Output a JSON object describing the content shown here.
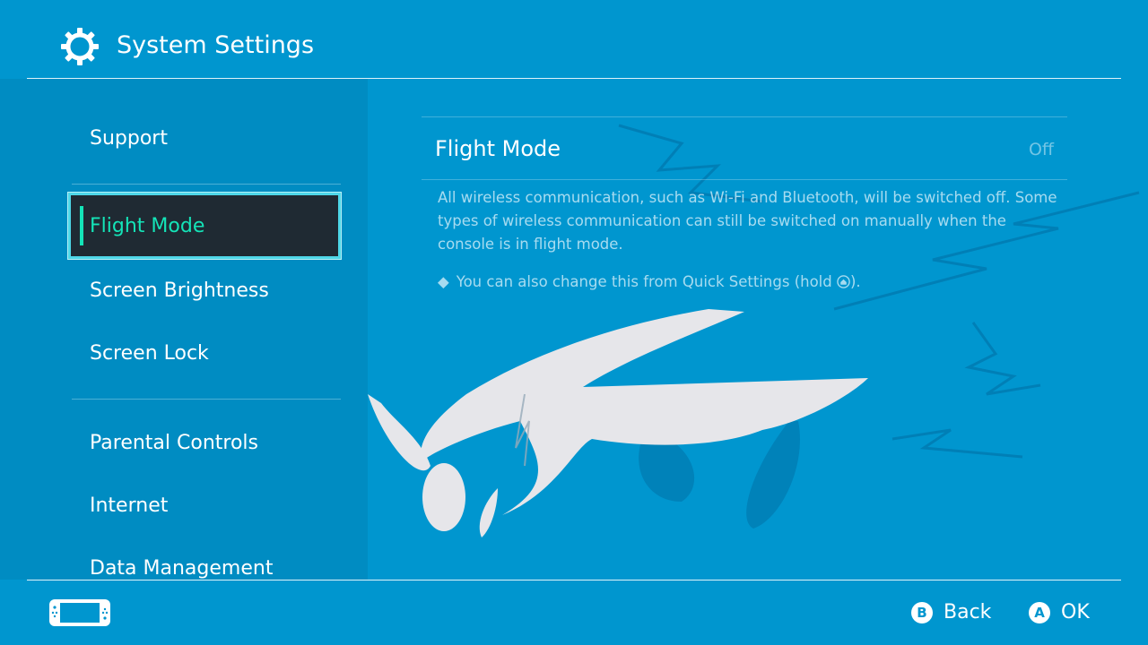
{
  "header": {
    "title": "System Settings",
    "icon": "gear-icon"
  },
  "sidebar": {
    "items": [
      {
        "label": "Support"
      },
      {
        "label": "Flight Mode",
        "selected": true
      },
      {
        "label": "Screen Brightness"
      },
      {
        "label": "Screen Lock"
      },
      {
        "label": "Parental Controls"
      },
      {
        "label": "Internet"
      },
      {
        "label": "Data Management"
      }
    ]
  },
  "content": {
    "title": "Flight Mode",
    "status": "Off",
    "description": "All wireless communication, such as Wi-Fi and Bluetooth, will be switched off. Some types of wireless communication can still be switched on manually when the console is in flight mode.",
    "note_prefix": "◆",
    "note_text": "You can also change this from Quick Settings (hold",
    "note_icon": "home-button-icon",
    "note_suffix": ")."
  },
  "footer": {
    "console_icon": "console-icon",
    "buttons": [
      {
        "glyph": "B",
        "label": "Back"
      },
      {
        "glyph": "A",
        "label": "OK"
      }
    ]
  },
  "colors": {
    "background": "#0096cf",
    "selected_bg": "#1f2a33",
    "selected_border": "#4ed7e8",
    "selected_text": "#14e4b8"
  }
}
